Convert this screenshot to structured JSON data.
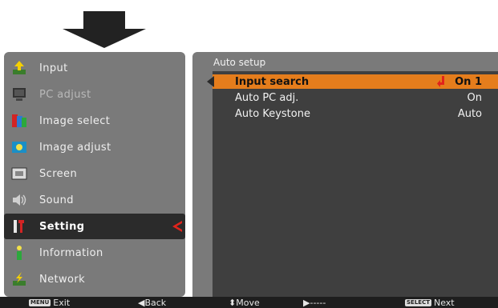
{
  "left_menu": {
    "items": [
      {
        "label": "Input",
        "icon": "input-icon",
        "state": "normal"
      },
      {
        "label": "PC adjust",
        "icon": "pc-adjust-icon",
        "state": "dim"
      },
      {
        "label": "Image select",
        "icon": "image-select-icon",
        "state": "normal"
      },
      {
        "label": "Image adjust",
        "icon": "image-adjust-icon",
        "state": "normal"
      },
      {
        "label": "Screen",
        "icon": "screen-icon",
        "state": "normal"
      },
      {
        "label": "Sound",
        "icon": "sound-icon",
        "state": "normal"
      },
      {
        "label": "Setting",
        "icon": "setting-icon",
        "state": "active"
      },
      {
        "label": "Information",
        "icon": "information-icon",
        "state": "normal"
      },
      {
        "label": "Network",
        "icon": "network-icon",
        "state": "normal"
      }
    ]
  },
  "right_panel": {
    "title": "Auto setup",
    "rows": [
      {
        "label": "Input search",
        "value": "On 1",
        "selected": true
      },
      {
        "label": "Auto PC adj.",
        "value": "On",
        "selected": false
      },
      {
        "label": "Auto Keystone",
        "value": "Auto",
        "selected": false
      }
    ]
  },
  "footer": {
    "exit_key": "MENU",
    "exit_label": "Exit",
    "back_label": "Back",
    "move_label": "Move",
    "enter_label": "-----",
    "next_key": "SELECT",
    "next_label": "Next"
  },
  "colors": {
    "panel": "#7a7a7a",
    "content_bg": "#3f3f3f",
    "highlight": "#e57d1c",
    "footer": "#1e1e1e",
    "accent_red": "#e1231b"
  }
}
